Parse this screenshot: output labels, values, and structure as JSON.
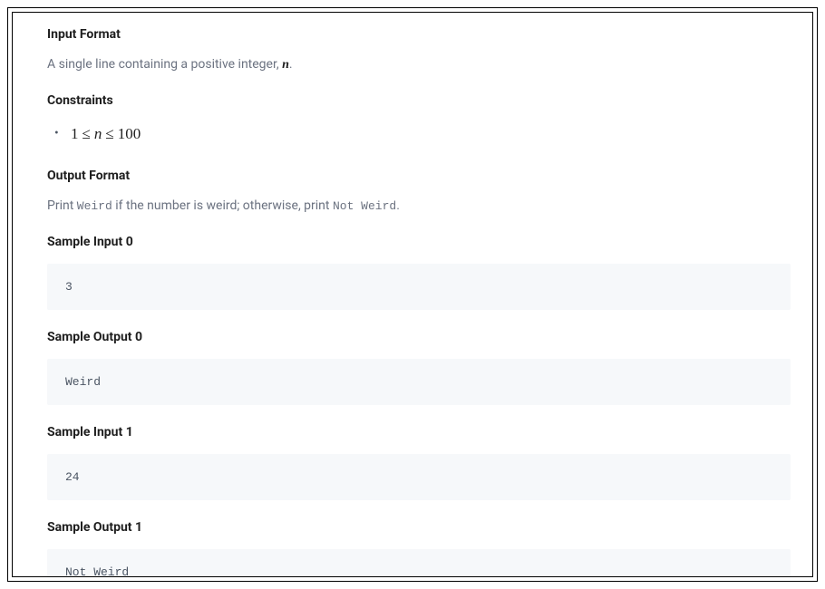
{
  "sections": {
    "input_format": {
      "heading": "Input Format",
      "text_before": "A single line containing a positive integer, ",
      "variable": "n",
      "text_after": "."
    },
    "constraints": {
      "heading": "Constraints",
      "expression": "1 ≤ n ≤ 100"
    },
    "output_format": {
      "heading": "Output Format",
      "text_before": "Print ",
      "code1": "Weird",
      "text_mid": " if the number is weird; otherwise, print ",
      "code2": "Not Weird",
      "text_after": "."
    },
    "samples": [
      {
        "input_heading": "Sample Input 0",
        "input_value": "3",
        "output_heading": "Sample Output 0",
        "output_value": "Weird"
      },
      {
        "input_heading": "Sample Input 1",
        "input_value": "24",
        "output_heading": "Sample Output 1",
        "output_value": "Not Weird"
      }
    ]
  }
}
